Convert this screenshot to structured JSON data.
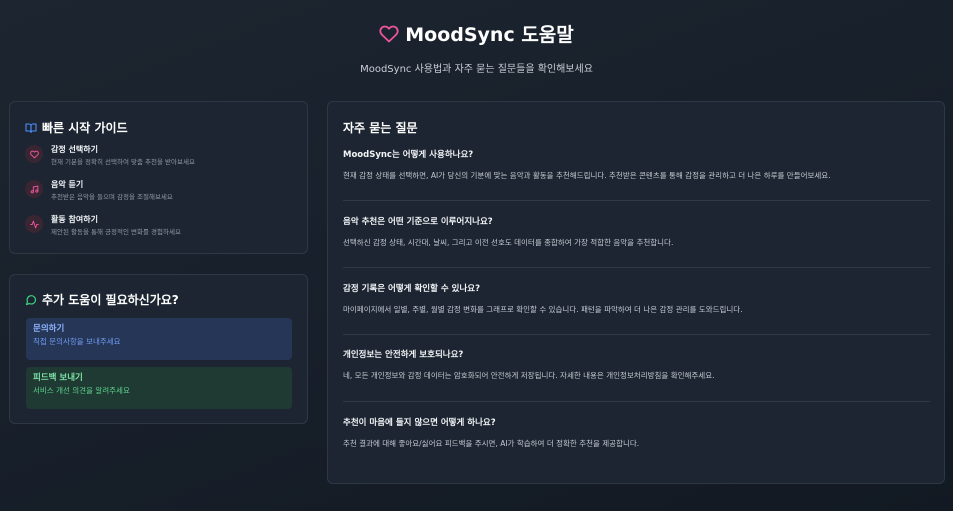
{
  "header": {
    "title": "MoodSync 도움말",
    "subtitle": "MoodSync 사용법과 자주 묻는 질문들을 확인해보세요"
  },
  "guide": {
    "title": "빠른 시작 가이드",
    "items": [
      {
        "icon": "heart-icon",
        "title": "감정 선택하기",
        "desc": "현재 기분을 정확히 선택하여 맞춤 추천을 받아보세요"
      },
      {
        "icon": "music-icon",
        "title": "음악 듣기",
        "desc": "추천받은 음악을 들으며 감정을 조절해보세요"
      },
      {
        "icon": "activity-icon",
        "title": "활동 참여하기",
        "desc": "제안된 활동을 통해 긍정적인 변화를 경험하세요"
      }
    ]
  },
  "help": {
    "title": "추가 도움이 필요하신가요?",
    "contact": {
      "title": "문의하기",
      "desc": "직접 문의사항을 보내주세요"
    },
    "feedback": {
      "title": "피드백 보내기",
      "desc": "서비스 개선 의견을 알려주세요"
    }
  },
  "faq": {
    "title": "자주 묻는 질문",
    "items": [
      {
        "q": "MoodSync는 어떻게 사용하나요?",
        "a": "현재 감정 상태를 선택하면, AI가 당신의 기분에 맞는 음악과 활동을 추천해드립니다. 추천받은 콘텐츠를 통해 감정을 관리하고 더 나은 하루를 만들어보세요."
      },
      {
        "q": "음악 추천은 어떤 기준으로 이루어지나요?",
        "a": "선택하신 감정 상태, 시간대, 날씨, 그리고 이전 선호도 데이터를 종합하여 가장 적합한 음악을 추천합니다."
      },
      {
        "q": "감정 기록은 어떻게 확인할 수 있나요?",
        "a": "마이페이지에서 일별, 주별, 월별 감정 변화를 그래프로 확인할 수 있습니다. 패턴을 파악하여 더 나은 감정 관리를 도와드립니다."
      },
      {
        "q": "개인정보는 안전하게 보호되나요?",
        "a": "네, 모든 개인정보와 감정 데이터는 암호화되어 안전하게 저장됩니다. 자세한 내용은 개인정보처리방침을 확인해주세요."
      },
      {
        "q": "추천이 마음에 들지 않으면 어떻게 하나요?",
        "a": "추천 결과에 대해 좋아요/싫어요 피드백을 주시면, AI가 학습하여 더 정확한 추천을 제공합니다."
      }
    ]
  },
  "colors": {
    "accent_pink": "#e8559a",
    "accent_blue": "#4f8dfd",
    "accent_green": "#3ecf7e"
  }
}
